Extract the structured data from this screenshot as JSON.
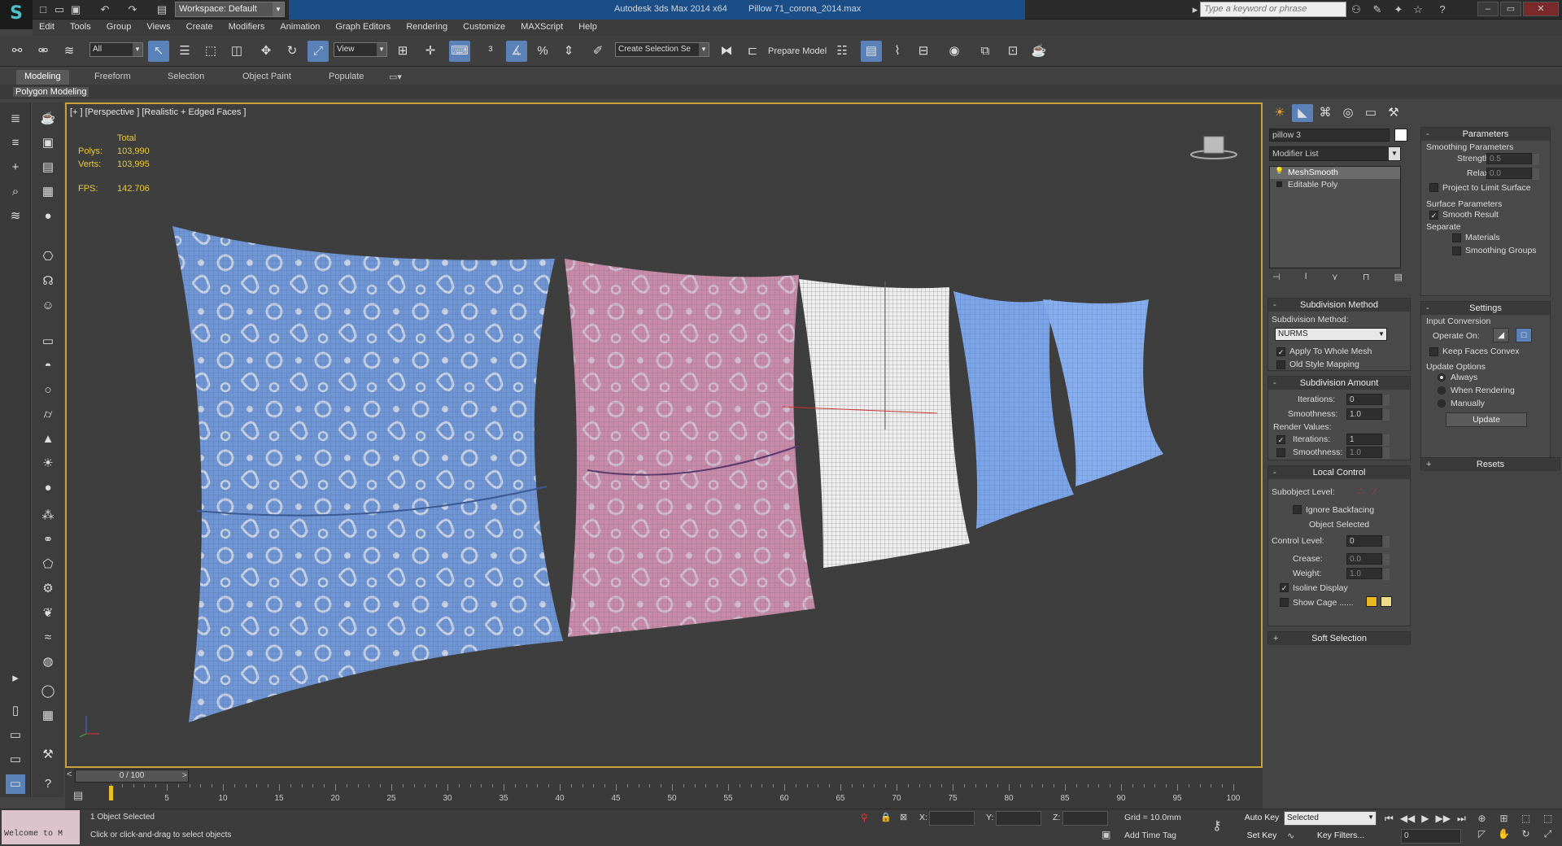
{
  "titlebar": {
    "app": "Autodesk 3ds Max  2014 x64",
    "file": "Pillow 71_corona_2014.max",
    "workspace": "Workspace: Default",
    "search_placeholder": "Type a keyword or phrase"
  },
  "menu": [
    "Edit",
    "Tools",
    "Group",
    "Views",
    "Create",
    "Modifiers",
    "Animation",
    "Graph Editors",
    "Rendering",
    "Customize",
    "MAXScript",
    "Help"
  ],
  "toolbar": {
    "filter": "All",
    "refcoord": "View",
    "selection_set": "Create Selection Se",
    "prepare_model": "Prepare Model"
  },
  "ribbon": {
    "tabs": [
      "Modeling",
      "Freeform",
      "Selection",
      "Object Paint",
      "Populate"
    ],
    "active_tab": "Modeling",
    "sub_label": "Polygon Modeling"
  },
  "viewport": {
    "label": "[+ ] [Perspective ] [Realistic + Edged Faces ]",
    "stats": {
      "header": "Total",
      "polys_label": "Polys:",
      "polys": "103,990",
      "verts_label": "Verts:",
      "verts": "103,995",
      "fps_label": "FPS:",
      "fps": "142.706"
    }
  },
  "command_panel": {
    "object_name": "pillow 3",
    "modifier_list": "Modifier List",
    "stack": [
      "MeshSmooth",
      "Editable Poly"
    ],
    "subdivision_method": {
      "title": "Subdivision Method",
      "method_label": "Subdivision Method:",
      "method": "NURMS",
      "apply_whole": "Apply To Whole Mesh",
      "old_style": "Old Style Mapping"
    },
    "subdivision_amount": {
      "title": "Subdivision Amount",
      "iterations_label": "Iterations:",
      "iterations": "0",
      "smoothness_label": "Smoothness:",
      "smoothness": "1.0",
      "render_values": "Render Values:",
      "r_iterations_label": "Iterations:",
      "r_iterations": "1",
      "r_smoothness_label": "Smoothness:",
      "r_smoothness": "1.0"
    },
    "local_control": {
      "title": "Local Control",
      "subobject_label": "Subobject Level:",
      "ignore_backfacing": "Ignore Backfacing",
      "object_selected": "Object Selected",
      "control_level_label": "Control Level:",
      "control_level": "0",
      "crease_label": "Crease:",
      "crease": "0.0",
      "weight_label": "Weight:",
      "weight": "1.0",
      "isoline": "Isoline Display",
      "show_cage": "Show Cage ......"
    },
    "soft_selection": "Soft Selection"
  },
  "right_panel": {
    "parameters": "Parameters",
    "smoothing_params": "Smoothing Parameters",
    "strength_label": "Strength:",
    "strength": "0.5",
    "relax_label": "Relax:",
    "relax": "0.0",
    "project_limit": "Project to Limit Surface",
    "surface_params": "Surface Parameters",
    "smooth_result": "Smooth Result",
    "separate": "Separate",
    "materials": "Materials",
    "smoothing_groups": "Smoothing Groups",
    "settings": "Settings",
    "input_conversion": "Input Conversion",
    "operate_on": "Operate On:",
    "keep_faces_convex": "Keep Faces Convex",
    "update_options": "Update Options",
    "always": "Always",
    "when_rendering": "When Rendering",
    "manually": "Manually",
    "update_btn": "Update",
    "resets": "Resets"
  },
  "timeline": {
    "slider": "0 / 100",
    "ticks": [
      "5",
      "10",
      "15",
      "20",
      "25",
      "30",
      "35",
      "40",
      "45",
      "50",
      "55",
      "60",
      "65",
      "70",
      "75",
      "80",
      "85",
      "90",
      "95",
      "100"
    ]
  },
  "status": {
    "welcome": "Welcome to M",
    "selected": "1 Object Selected",
    "prompt": "Click or click-and-drag to select objects",
    "x_label": "X:",
    "y_label": "Y:",
    "z_label": "Z:",
    "grid": "Grid = 10.0mm",
    "add_time_tag": "Add Time Tag",
    "auto_key": "Auto Key",
    "set_key": "Set Key",
    "key_mode": "Selected",
    "key_filters": "Key Filters...",
    "frame": "0"
  },
  "colors": {
    "accent": "#5a82b8",
    "viewport_border": "#c8a23a",
    "stats": "#e9c93a"
  }
}
